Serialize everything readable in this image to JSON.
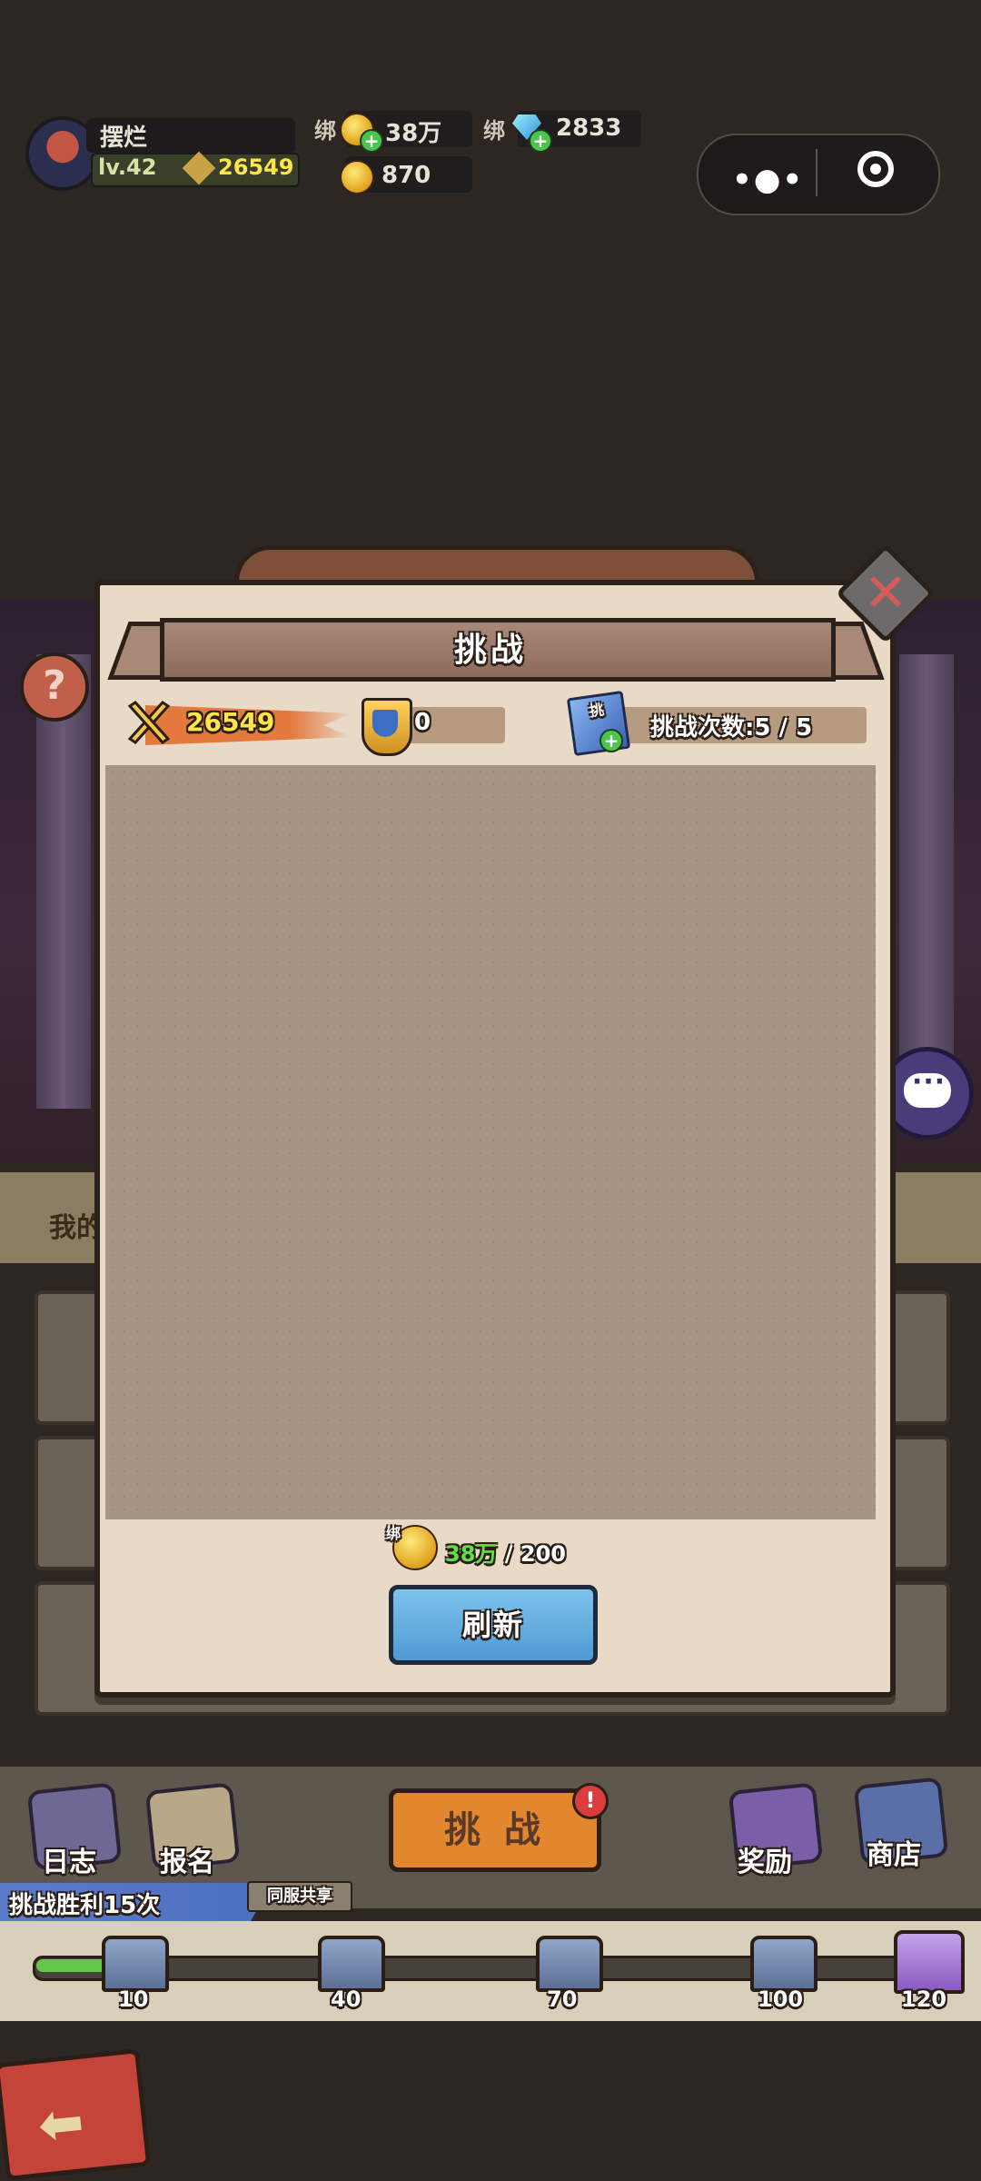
{
  "hud": {
    "player_name": "摆烂",
    "level": "lv.42",
    "power": "26549",
    "bound_label_1": "绑",
    "gold": "38万",
    "bound_label_2": "绑",
    "diamonds": "2833",
    "coins": "870"
  },
  "background": {
    "my_label": "我的"
  },
  "modal": {
    "title": "挑战",
    "power": "26549",
    "badge_count": "0",
    "ticket_label": "挑",
    "attempts": "挑战次数:5 / 5",
    "cost_bound_tag": "绑",
    "cost_have": "38万",
    "cost_sep_need": " / 200",
    "refresh_label": "刷新"
  },
  "bottom_nav": {
    "log": "日志",
    "signup": "报名",
    "challenge": "挑 战",
    "challenge_badge": "!",
    "rewards": "奖励",
    "shop": "商店"
  },
  "progress": {
    "win_text": "挑战胜利15次",
    "share_tag": "同服共享",
    "milestones": [
      "10",
      "40",
      "70",
      "100",
      "120"
    ],
    "current_fraction": 0.08
  },
  "colors": {
    "modal_bg": "#e8dac6",
    "content_bg": "#a89482",
    "power_yellow": "#ffe44a",
    "refresh_blue": "#6fb4e4",
    "challenge_orange": "#e2872e",
    "close_red": "#d65b5b"
  }
}
